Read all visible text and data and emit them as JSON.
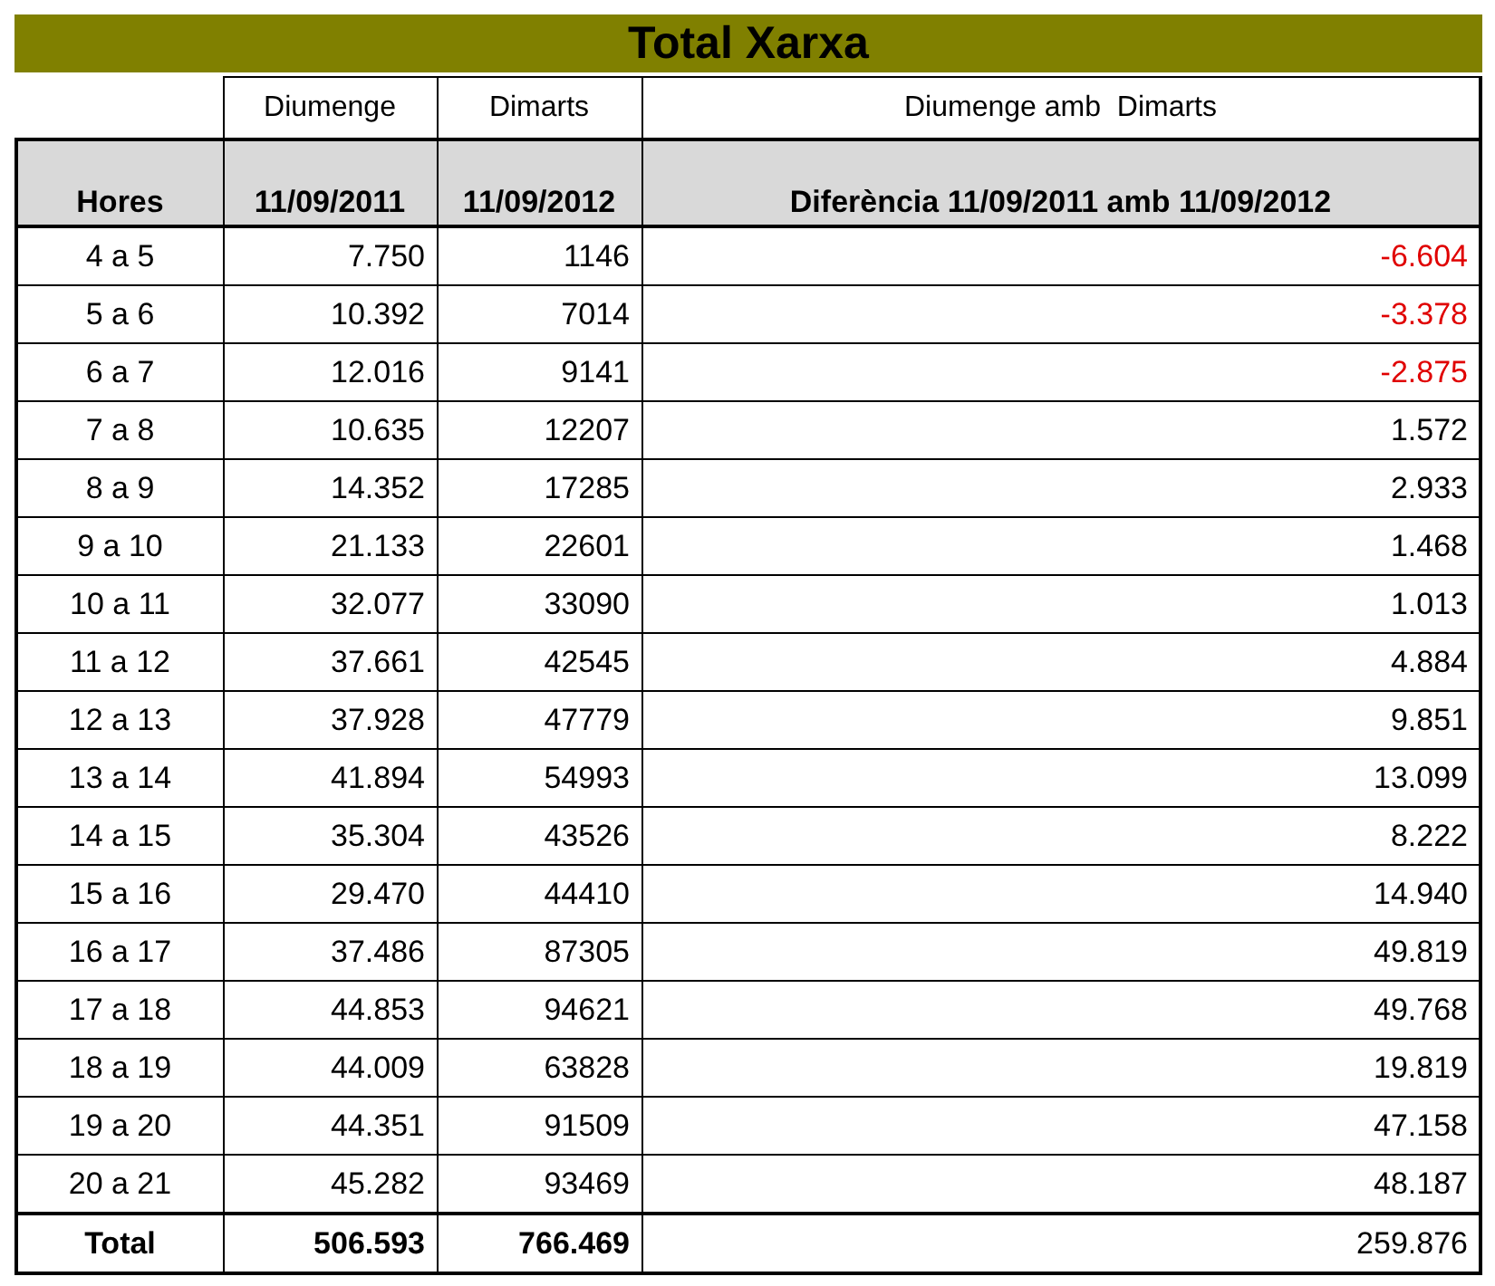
{
  "title": "Total Xarxa",
  "header_top": [
    "Diumenge",
    "Dimarts",
    "Diumenge amb  Dimarts"
  ],
  "columns": [
    "Hores",
    "11/09/2011",
    "11/09/2012",
    "Diferència 11/09/2011 amb 11/09/2012"
  ],
  "rows": [
    {
      "hores": "4 a 5",
      "d2011": "7.750",
      "d2012": "1146",
      "diff": "-6.604",
      "negative": true
    },
    {
      "hores": "5 a 6",
      "d2011": "10.392",
      "d2012": "7014",
      "diff": "-3.378",
      "negative": true
    },
    {
      "hores": "6 a 7",
      "d2011": "12.016",
      "d2012": "9141",
      "diff": "-2.875",
      "negative": true
    },
    {
      "hores": "7 a 8",
      "d2011": "10.635",
      "d2012": "12207",
      "diff": "1.572",
      "negative": false
    },
    {
      "hores": "8 a 9",
      "d2011": "14.352",
      "d2012": "17285",
      "diff": "2.933",
      "negative": false
    },
    {
      "hores": "9 a 10",
      "d2011": "21.133",
      "d2012": "22601",
      "diff": "1.468",
      "negative": false
    },
    {
      "hores": "10 a 11",
      "d2011": "32.077",
      "d2012": "33090",
      "diff": "1.013",
      "negative": false
    },
    {
      "hores": "11 a 12",
      "d2011": "37.661",
      "d2012": "42545",
      "diff": "4.884",
      "negative": false
    },
    {
      "hores": "12 a 13",
      "d2011": "37.928",
      "d2012": "47779",
      "diff": "9.851",
      "negative": false
    },
    {
      "hores": "13 a 14",
      "d2011": "41.894",
      "d2012": "54993",
      "diff": "13.099",
      "negative": false
    },
    {
      "hores": "14 a 15",
      "d2011": "35.304",
      "d2012": "43526",
      "diff": "8.222",
      "negative": false
    },
    {
      "hores": "15 a 16",
      "d2011": "29.470",
      "d2012": "44410",
      "diff": "14.940",
      "negative": false
    },
    {
      "hores": "16 a 17",
      "d2011": "37.486",
      "d2012": "87305",
      "diff": "49.819",
      "negative": false
    },
    {
      "hores": "17 a 18",
      "d2011": "44.853",
      "d2012": "94621",
      "diff": "49.768",
      "negative": false
    },
    {
      "hores": "18 a 19",
      "d2011": "44.009",
      "d2012": "63828",
      "diff": "19.819",
      "negative": false
    },
    {
      "hores": "19 a 20",
      "d2011": "44.351",
      "d2012": "91509",
      "diff": "47.158",
      "negative": false
    },
    {
      "hores": "20 a 21",
      "d2011": "45.282",
      "d2012": "93469",
      "diff": "48.187",
      "negative": false
    }
  ],
  "total": {
    "label": "Total",
    "d2011": "506.593",
    "d2012": "766.469",
    "diff": "259.876"
  }
}
